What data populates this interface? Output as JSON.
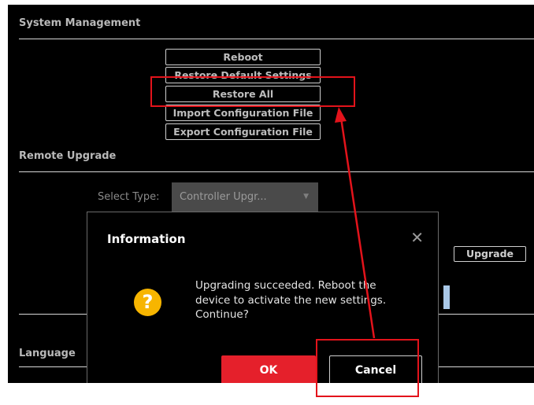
{
  "system_management": {
    "title": "System Management",
    "buttons": [
      "Reboot",
      "Restore Default Settings",
      "Restore All",
      "Import Configuration File",
      "Export Configuration File"
    ]
  },
  "remote_upgrade": {
    "title": "Remote Upgrade",
    "select_label": "Select Type:",
    "select_value": "Controller Upgr...",
    "upgrade_button": "Upgrade"
  },
  "language": {
    "title": "Language"
  },
  "dialog": {
    "title": "Information",
    "message": "Upgrading succeeded. Reboot the device to activate the new settings. Continue?",
    "ok_label": "OK",
    "cancel_label": "Cancel"
  },
  "icons": {
    "close": "close-icon",
    "question": "question-icon",
    "dropdown": "chevron-down-icon"
  },
  "colors": {
    "ok_button": "#e5202b",
    "question_icon": "#f7b500",
    "annotation": "#e3131b"
  }
}
